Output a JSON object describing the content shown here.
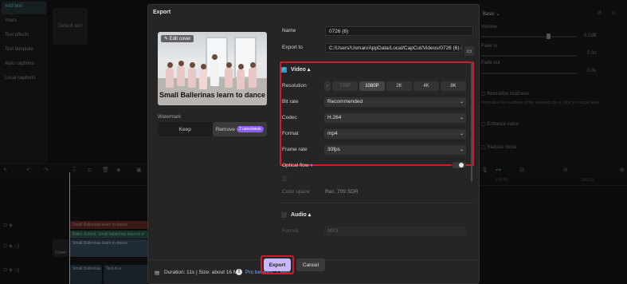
{
  "background": {
    "left_categories": [
      "Add text",
      "Yours",
      "Text effects",
      "Text template",
      "Auto captions",
      "Local captions"
    ],
    "default_text_tile": "Default text",
    "right_panel": {
      "section": "Basic",
      "volume_label": "Volume",
      "volume_value": "0.0dB",
      "fade_in_label": "Fade in",
      "fade_in_value": "0.0s",
      "fade_out_label": "Fade out",
      "fade_out_value": "0.0s",
      "normalize_label": "Normalize loudness",
      "normalize_desc": "Normalize the loudness of the selected clip or clips to a target level.",
      "enhance_voice_label": "Enhance voice",
      "reduce_noise_label": "Reduce noise"
    },
    "timeline": {
      "ruler_ticks": [
        "100:00",
        "100:30"
      ],
      "clip_text_track": "Small Ballerinas learn to dance",
      "clip_title_track": "Ballet School: Small ballerinas learn to d",
      "clip_video_a": "Small Ballerinas learn to dance",
      "clip_video_b": "Text-to-s",
      "cover_label": "Cover"
    }
  },
  "dialog": {
    "title": "Export",
    "cover": {
      "edit_label": "Edit cover",
      "caption": "Small Ballerinas learn to dance"
    },
    "watermark": {
      "label": "Watermark",
      "keep": "Keep",
      "remove": "Remove",
      "remove_badge": "2 uses/week",
      "selected": "Remove"
    },
    "name_label": "Name",
    "name_value": "0726 (6)",
    "export_to_label": "Export to",
    "export_to_value": "C:/Users/Usman/AppData/Local/CapCut/Videos/0726 (6).mp4",
    "video": {
      "section": "Video",
      "enabled": true,
      "resolution_label": "Resolution",
      "resolutions": [
        "720P",
        "1080P",
        "2K",
        "4K",
        "8K"
      ],
      "resolution_selected": "1080P",
      "bitrate_label": "Bit rate",
      "bitrate_value": "Recommended",
      "codec_label": "Codec",
      "codec_value": "H.264",
      "format_label": "Format",
      "format_value": "mp4",
      "framerate_label": "Frame rate",
      "framerate_value": "30fps"
    },
    "optical_flow_label": "Optical flow",
    "color_space_label": "Color space",
    "color_space_value": "Rec. 709 SDR",
    "audio": {
      "section": "Audio",
      "enabled": false,
      "format_label": "Format",
      "format_value": "MP3"
    },
    "footer": {
      "duration_size": "Duration: 11s | Size: about 16 MB",
      "pro_benefits": "Pro benefits: 1 item",
      "export_button": "Export",
      "cancel_button": "Cancel"
    },
    "highlight_color": "#d11a2a",
    "accent_color": "#c9b8ff"
  }
}
